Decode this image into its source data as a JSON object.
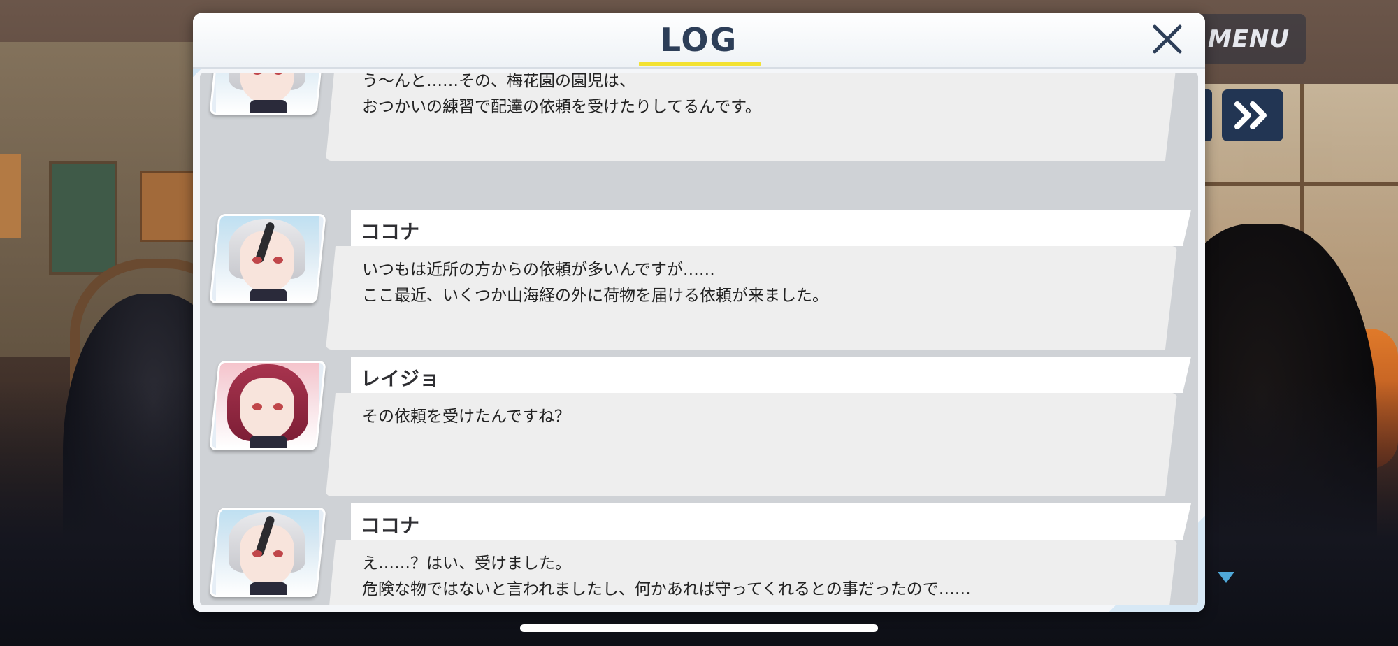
{
  "hud": {
    "menu_label": "MENU",
    "fast_forward_icon": "double-chevron-right-icon"
  },
  "log": {
    "title": "LOG",
    "close_icon": "close-icon",
    "entries": [
      {
        "speaker": "",
        "avatar": "kokona-portrait",
        "lines": [
          "う〜んと……その、梅花園の園児は、",
          "おつかいの練習で配達の依頼を受けたりしてるんです。"
        ]
      },
      {
        "speaker": "ココナ",
        "avatar": "kokona-portrait",
        "lines": [
          "いつもは近所の方からの依頼が多いんですが……",
          "ここ最近、いくつか山海経の外に荷物を届ける依頼が来ました。"
        ]
      },
      {
        "speaker": "レイジョ",
        "avatar": "reijo-portrait",
        "lines": [
          "その依頼を受けたんですね？"
        ]
      },
      {
        "speaker": "ココナ",
        "avatar": "kokona-portrait",
        "lines": [
          "え……？はい、受けました。",
          "危険な物ではないと言われましたし、何かあれば守ってくれるとの事だったので……"
        ]
      }
    ]
  },
  "colors": {
    "title": "#2d3e58",
    "title_underline": "#f3e232",
    "hud_button": "#223553",
    "scroll_indicator": "#4fa8d8"
  }
}
